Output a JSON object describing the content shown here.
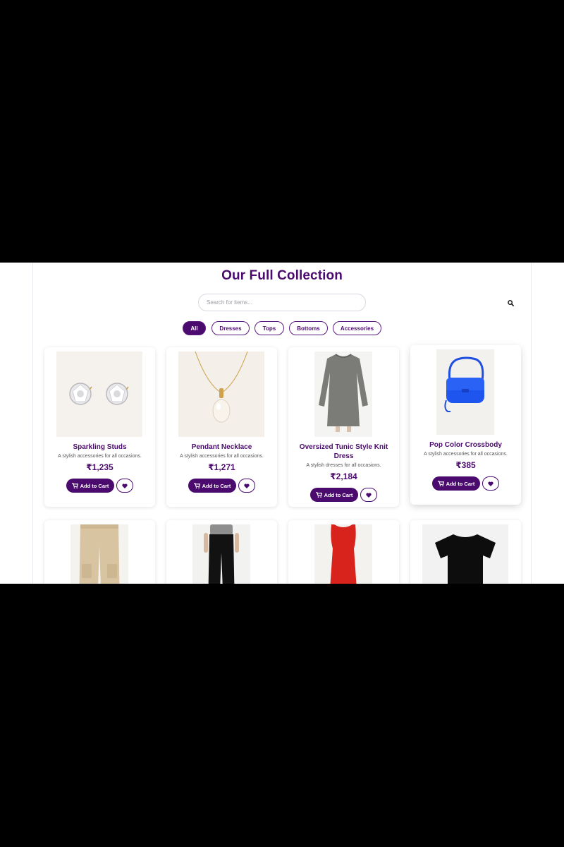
{
  "page": {
    "heading": "Our Full Collection",
    "colors": {
      "brand": "#4b0a6e",
      "background": "#ffffff"
    }
  },
  "search": {
    "placeholder": "Search for items...",
    "value": "",
    "icon": "search-icon"
  },
  "filters": [
    {
      "label": "All",
      "active": true
    },
    {
      "label": "Dresses",
      "active": false
    },
    {
      "label": "Tops",
      "active": false
    },
    {
      "label": "Bottoms",
      "active": false
    },
    {
      "label": "Accessories",
      "active": false
    }
  ],
  "products": [
    {
      "name": "Sparkling Studs",
      "description": "A stylish accessories for all occasions.",
      "price": "₹1,235",
      "cart_label": "Add to Cart",
      "image": "stud-earrings"
    },
    {
      "name": "Pendant Necklace",
      "description": "A stylish accessories for all occasions.",
      "price": "₹1,271",
      "cart_label": "Add to Cart",
      "image": "pearl-necklace"
    },
    {
      "name": "Oversized Tunic Style Knit Dress",
      "description": "A stylish dresses for all occasions.",
      "price": "₹2,184",
      "cart_label": "Add to Cart",
      "image": "grey-knit-dress"
    },
    {
      "name": "Pop Color Crossbody",
      "description": "A stylish accessories for all occasions.",
      "price": "₹385",
      "cart_label": "Add to Cart",
      "image": "blue-crossbody-bag"
    },
    {
      "name": "",
      "description": "",
      "price": "",
      "cart_label": "",
      "image": "beige-cargo-pants"
    },
    {
      "name": "",
      "description": "",
      "price": "",
      "cart_label": "",
      "image": "black-trousers"
    },
    {
      "name": "",
      "description": "",
      "price": "",
      "cart_label": "",
      "image": "red-dress"
    },
    {
      "name": "",
      "description": "",
      "price": "",
      "cart_label": "",
      "image": "black-tshirt"
    }
  ]
}
